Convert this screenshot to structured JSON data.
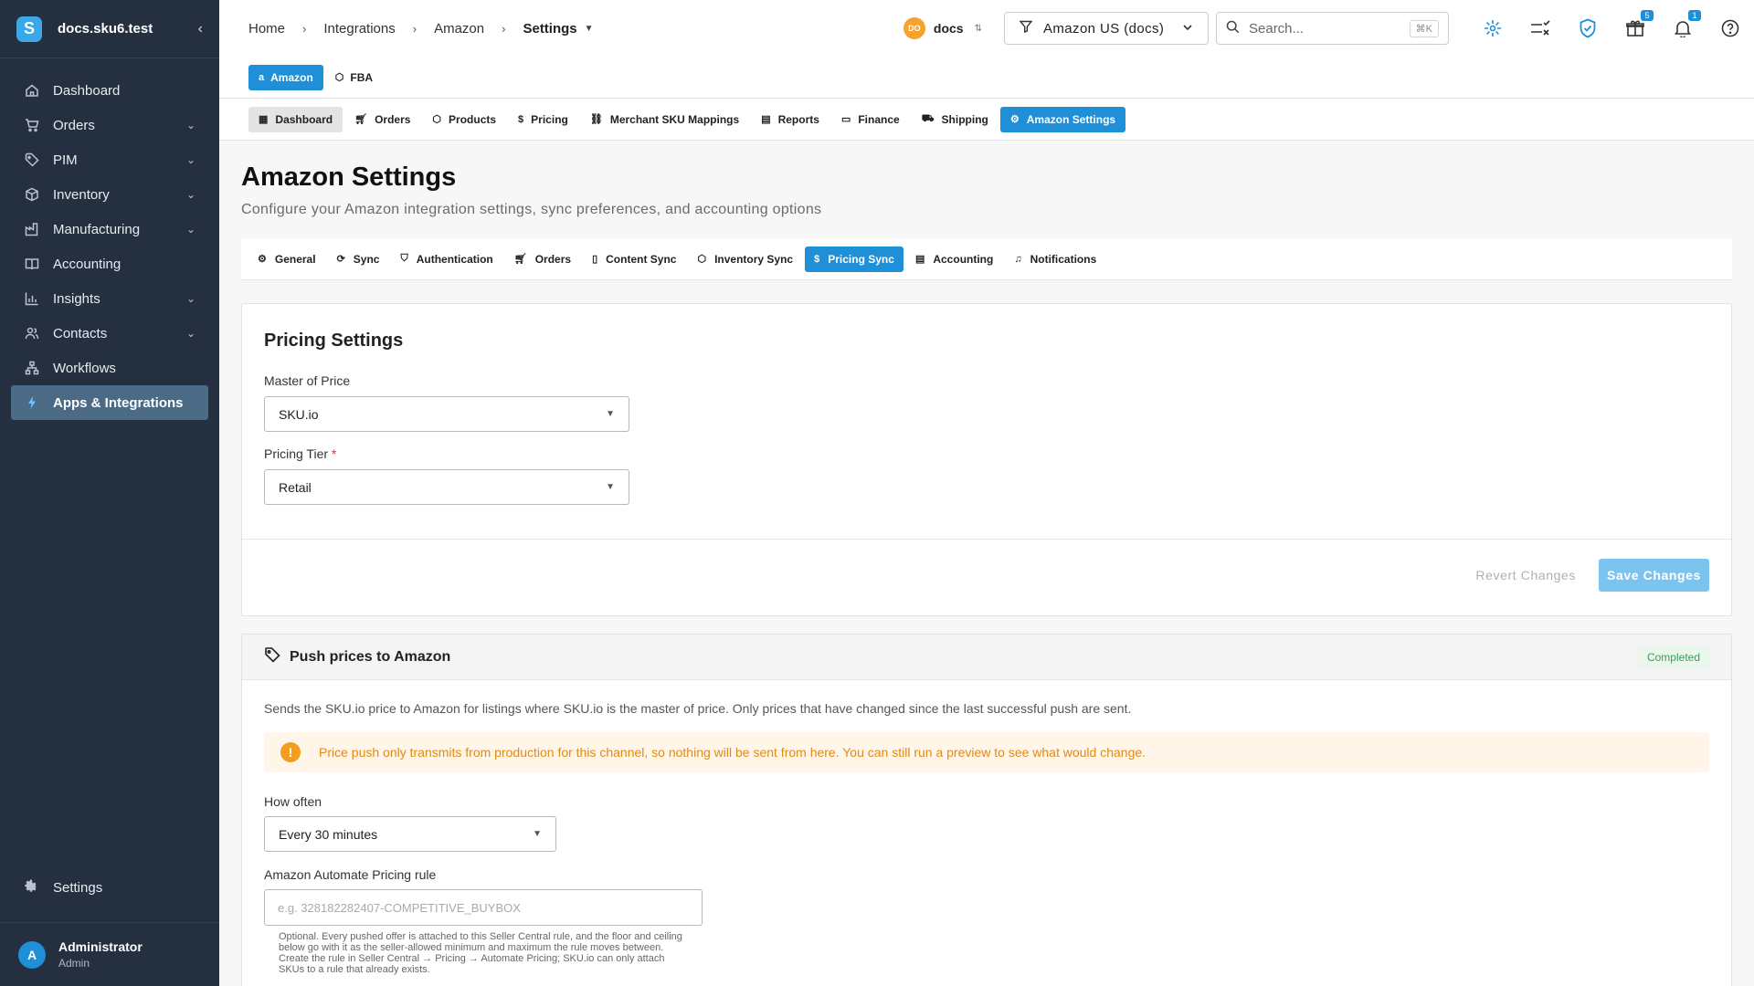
{
  "sidebar": {
    "org_name": "docs.sku6.test",
    "logo_letter": "S",
    "collapse_label": "‹",
    "items": [
      {
        "label": "Dashboard",
        "icon": "home-icon",
        "has_children": false
      },
      {
        "label": "Orders",
        "icon": "cart-icon",
        "has_children": true
      },
      {
        "label": "PIM",
        "icon": "tag-icon",
        "has_children": true
      },
      {
        "label": "Inventory",
        "icon": "box-icon",
        "has_children": true
      },
      {
        "label": "Manufacturing",
        "icon": "factory-icon",
        "has_children": true
      },
      {
        "label": "Accounting",
        "icon": "book-icon",
        "has_children": false
      },
      {
        "label": "Insights",
        "icon": "chart-icon",
        "has_children": true
      },
      {
        "label": "Contacts",
        "icon": "users-icon",
        "has_children": true
      },
      {
        "label": "Workflows",
        "icon": "workflow-icon",
        "has_children": false
      },
      {
        "label": "Apps & Integrations",
        "icon": "integrations-icon",
        "has_children": false,
        "active": true
      }
    ],
    "settings_label": "Settings",
    "user": {
      "initial": "A",
      "name": "Administrator",
      "role": "Admin"
    }
  },
  "topbar": {
    "breadcrumbs": [
      "Home",
      "Integrations",
      "Amazon",
      "Settings"
    ],
    "workspace_badge": "DO",
    "workspace_name": "docs",
    "store_selector": "Amazon US (docs)",
    "search_placeholder": "Search...",
    "search_shortcut": "⌘K",
    "gift_badge": "5",
    "notification_badge": "1"
  },
  "channel_tabs": [
    {
      "label": "Amazon",
      "active": true
    },
    {
      "label": "FBA",
      "active": false
    }
  ],
  "sub_nav": [
    {
      "label": "Dashboard",
      "icon": "dashboard-icon",
      "state": "gray"
    },
    {
      "label": "Orders",
      "icon": "cart-icon",
      "state": ""
    },
    {
      "label": "Products",
      "icon": "box-icon",
      "state": ""
    },
    {
      "label": "Pricing",
      "icon": "dollar-icon",
      "state": ""
    },
    {
      "label": "Merchant SKU Mappings",
      "icon": "link-icon",
      "state": ""
    },
    {
      "label": "Reports",
      "icon": "report-icon",
      "state": ""
    },
    {
      "label": "Finance",
      "icon": "money-icon",
      "state": ""
    },
    {
      "label": "Shipping",
      "icon": "truck-icon",
      "state": ""
    },
    {
      "label": "Amazon Settings",
      "icon": "gear-icon",
      "state": "active"
    }
  ],
  "page": {
    "title": "Amazon Settings",
    "subtitle": "Configure your Amazon integration settings, sync preferences, and accounting options"
  },
  "settings_tabs": [
    {
      "label": "General",
      "icon": "gear-icon",
      "active": false
    },
    {
      "label": "Sync",
      "icon": "sync-icon",
      "active": false
    },
    {
      "label": "Authentication",
      "icon": "shield-icon",
      "active": false
    },
    {
      "label": "Orders",
      "icon": "cart-icon",
      "active": false
    },
    {
      "label": "Content Sync",
      "icon": "document-icon",
      "active": false
    },
    {
      "label": "Inventory Sync",
      "icon": "box-icon",
      "active": false
    },
    {
      "label": "Pricing Sync",
      "icon": "dollar-icon",
      "active": true
    },
    {
      "label": "Accounting",
      "icon": "calculator-icon",
      "active": false
    },
    {
      "label": "Notifications",
      "icon": "bell-icon",
      "active": false
    }
  ],
  "pricing_settings": {
    "heading": "Pricing Settings",
    "master_label": "Master of Price",
    "master_value": "SKU.io",
    "tier_label": "Pricing Tier",
    "tier_required": "*",
    "tier_value": "Retail",
    "revert_label": "Revert Changes",
    "save_label": "Save Changes"
  },
  "push_prices": {
    "title": "Push prices to Amazon",
    "status": "Completed",
    "description": "Sends the SKU.io price to Amazon for listings where SKU.io is the master of price. Only prices that have changed since the last successful push are sent.",
    "warning_icon": "!",
    "warning": "Price push only transmits from production for this channel, so nothing will be sent from here. You can still run a preview to see what would change.",
    "frequency_label": "How often",
    "frequency_value": "Every 30 minutes",
    "rule_label": "Amazon Automate Pricing rule",
    "rule_placeholder": "e.g. 328182282407-COMPETITIVE_BUYBOX",
    "rule_help": "Optional. Every pushed offer is attached to this Seller Central rule, and the floor and ceiling below go with it as the seller-allowed minimum and maximum the rule moves between. Create the rule in Seller Central → Pricing → Automate Pricing; SKU.io can only attach SKUs to a rule that already exists."
  },
  "colors": {
    "accent": "#1f8fd8",
    "sidebar": "#24303f",
    "warning": "#f39d1f",
    "success": "#3c9b56"
  }
}
